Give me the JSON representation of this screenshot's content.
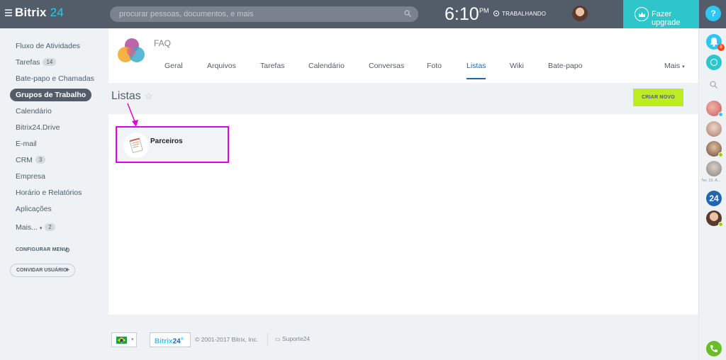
{
  "header": {
    "logo_text": "Bitrix",
    "logo_num": "24",
    "search_placeholder": "procurar pessoas, documentos, e mais",
    "time": "6:10",
    "ampm": "PM",
    "status": "TRABALHANDO",
    "upgrade_label": "Fazer upgrade",
    "help": "?"
  },
  "sidebar": {
    "items": [
      {
        "label": "Fluxo de Atividades"
      },
      {
        "label": "Tarefas",
        "count": "14"
      },
      {
        "label": "Bate-papo e Chamadas"
      },
      {
        "label": "Grupos de Trabalho",
        "active": true
      },
      {
        "label": "Calendário"
      },
      {
        "label": "Bitrix24.Drive"
      },
      {
        "label": "E-mail"
      },
      {
        "label": "CRM",
        "count": "3"
      },
      {
        "label": "Empresa"
      },
      {
        "label": "Horário e Relatórios"
      },
      {
        "label": "Aplicações"
      },
      {
        "label": "Mais...",
        "count": "2"
      }
    ],
    "configure": "CONFIGURAR MENU",
    "invite": "CONVIDAR USUÁRIO"
  },
  "group": {
    "title": "FAQ",
    "tabs": [
      "Geral",
      "Arquivos",
      "Tarefas",
      "Calendário",
      "Conversas",
      "Foto",
      "Listas",
      "Wiki",
      "Bate-papo"
    ],
    "active_tab": "Listas",
    "more": "Mais"
  },
  "page": {
    "title": "Listas",
    "create_button": "CRIAR NOVO"
  },
  "lists": [
    {
      "label": "Parceiros"
    }
  ],
  "footer": {
    "brand_text": "Bitrix",
    "brand_num": "24",
    "copyright": "© 2001-2017 Bitrix, Inc.",
    "support": "Suporte24"
  },
  "rightbar": {
    "notification_count": "8",
    "date_label": "Ter, 15. A...",
    "b24_label": "24"
  },
  "colors": {
    "header_bg": "#535c69",
    "accent": "#2fc6f6",
    "active_tab": "#2067b0",
    "create_button": "#bbed21",
    "highlight": "#e100e1"
  }
}
